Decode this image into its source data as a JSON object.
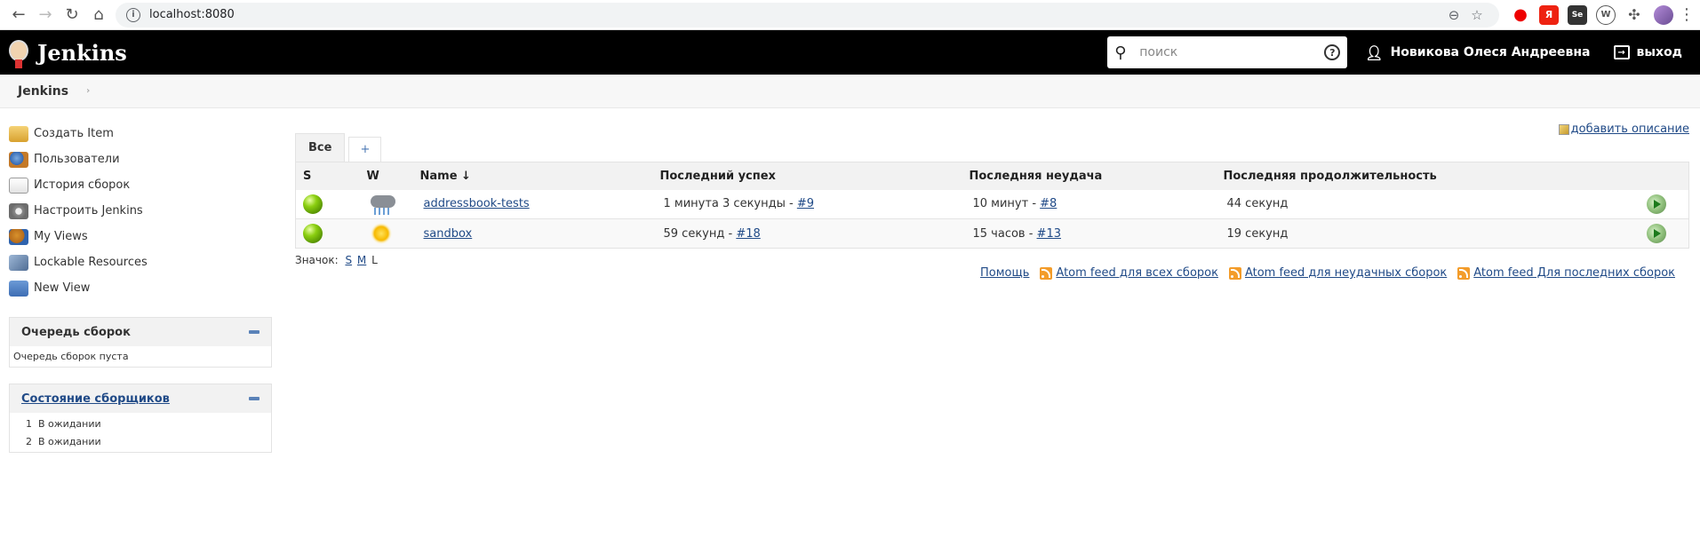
{
  "browser": {
    "url": "localhost:8080"
  },
  "header": {
    "logo_text": "Jenkins",
    "search_placeholder": "поиск",
    "user_name": "Новикова Олеся Андреевна",
    "logout_label": "выход"
  },
  "breadcrumb": {
    "root": "Jenkins"
  },
  "sidebar": {
    "tasks": [
      {
        "label": "Создать Item",
        "icon": "new-item-icon"
      },
      {
        "label": "Пользователи",
        "icon": "people-icon"
      },
      {
        "label": "История сборок",
        "icon": "build-history-icon"
      },
      {
        "label": "Настроить Jenkins",
        "icon": "gear-icon"
      },
      {
        "label": "My Views",
        "icon": "user-views-icon"
      },
      {
        "label": "Lockable Resources",
        "icon": "lock-icon"
      },
      {
        "label": "New View",
        "icon": "folder-icon"
      }
    ],
    "queue": {
      "title": "Очередь сборок",
      "empty_text": "Очередь сборок пуста"
    },
    "executors": {
      "title": "Состояние сборщиков",
      "rows": [
        {
          "num": "1",
          "status": "В ожидании"
        },
        {
          "num": "2",
          "status": "В ожидании"
        }
      ]
    }
  },
  "content": {
    "add_description": "добавить описание",
    "tabs": [
      {
        "label": "Все"
      },
      {
        "label": "+"
      }
    ],
    "table": {
      "headers": {
        "s": "S",
        "w": "W",
        "name": "Name ↓",
        "last_success": "Последний успех",
        "last_failure": "Последняя неудача",
        "last_duration": "Последняя продолжительность"
      },
      "rows": [
        {
          "status": "success",
          "weather": "stormy",
          "name": "addressbook-tests",
          "last_success": "1 минута 3 секунды - ",
          "last_success_build": "#9",
          "last_failure": "10 минут - ",
          "last_failure_build": "#8",
          "duration": "44 секунд"
        },
        {
          "status": "success",
          "weather": "sunny",
          "name": "sandbox",
          "last_success": "59 секунд - ",
          "last_success_build": "#18",
          "last_failure": "15 часов - ",
          "last_failure_build": "#13",
          "duration": "19 секунд"
        }
      ]
    },
    "legend": {
      "label": "Значок:",
      "sizes": [
        "S",
        "M",
        "L"
      ]
    },
    "footer_links": {
      "help": "Помощь",
      "feed_all": "Atom feed для всех сборок",
      "feed_failed": "Atom feed для неудачных сборок",
      "feed_latest": "Atom feed Для последних сборок"
    }
  }
}
